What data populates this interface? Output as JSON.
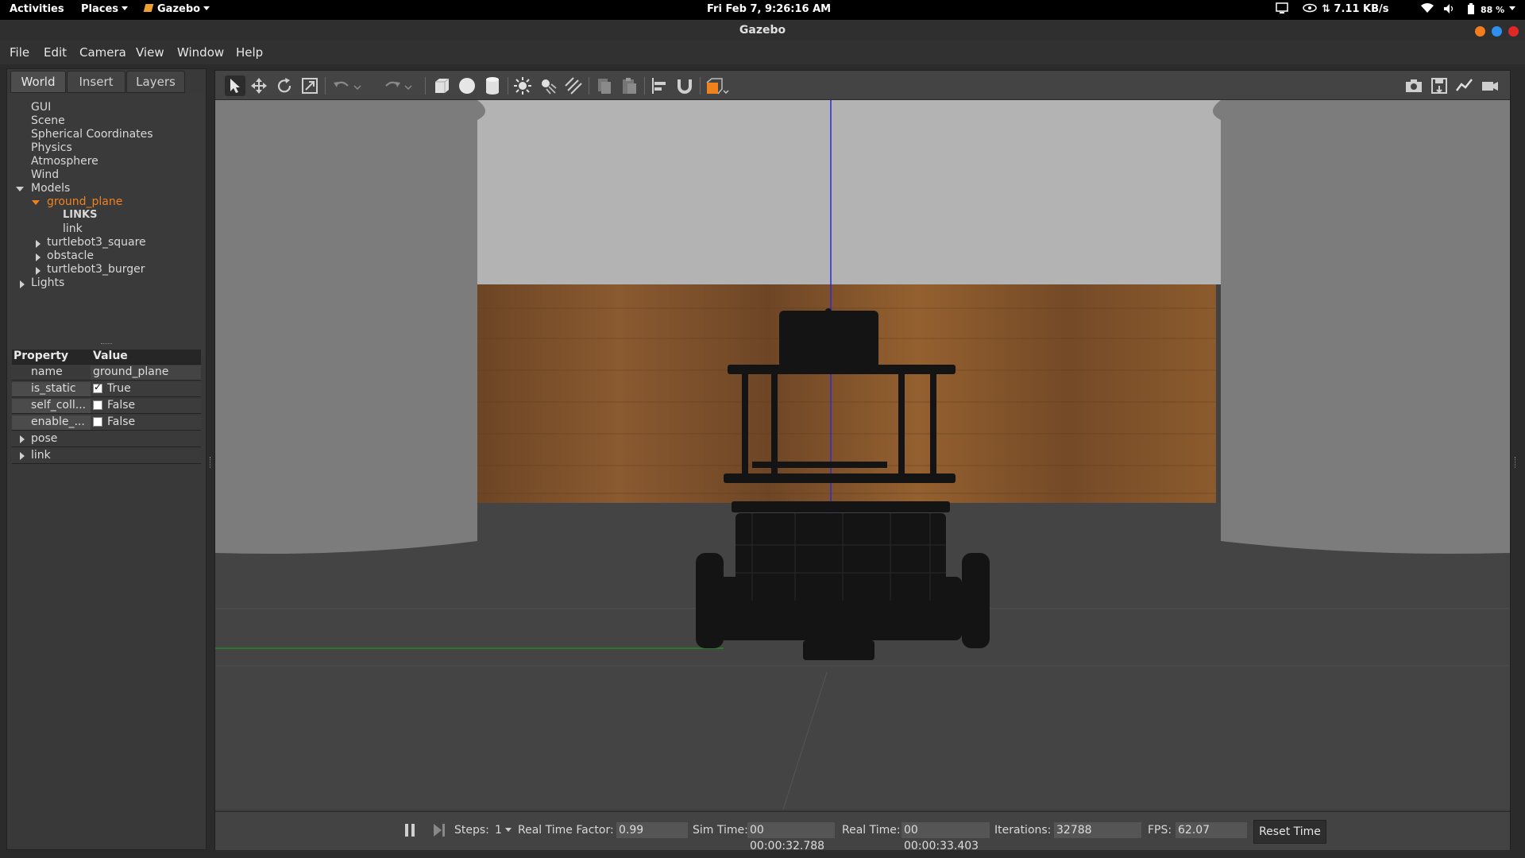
{
  "topbar": {
    "activities": "Activities",
    "places": "Places",
    "app": "Gazebo",
    "clock": "Fri Feb  7,  9:26:16 AM",
    "net_speed": "⇅ 7.11 KB/s",
    "battery": "88 %"
  },
  "window": {
    "title": "Gazebo"
  },
  "menu": {
    "items": [
      "File",
      "Edit",
      "Camera",
      "View",
      "Window",
      "Help"
    ]
  },
  "left_panel": {
    "tabs": [
      "World",
      "Insert",
      "Layers"
    ],
    "tree": {
      "gui": "GUI",
      "scene": "Scene",
      "spherical": "Spherical Coordinates",
      "physics": "Physics",
      "atmosphere": "Atmosphere",
      "wind": "Wind",
      "models": "Models",
      "ground_plane": "ground_plane",
      "links": "LINKS",
      "link": "link",
      "turtlebot3_square": "turtlebot3_square",
      "obstacle": "obstacle",
      "turtlebot3_burger": "turtlebot3_burger",
      "lights": "Lights"
    },
    "properties": {
      "header_property": "Property",
      "header_value": "Value",
      "rows": [
        {
          "name": "name",
          "value": "ground_plane"
        },
        {
          "name": "is_static",
          "value": "True",
          "checked": true
        },
        {
          "name": "self_coll...",
          "value": "False",
          "checked": false
        },
        {
          "name": "enable_...",
          "value": "False",
          "checked": false
        },
        {
          "name": "pose"
        },
        {
          "name": "link"
        }
      ]
    }
  },
  "statusbar": {
    "steps_label": "Steps:",
    "steps_value": "1",
    "rtf_label": "Real Time Factor:",
    "rtf_value": "0.99",
    "sim_time_label": "Sim Time:",
    "sim_time_value": "00 00:00:32.788",
    "real_time_label": "Real Time:",
    "real_time_value": "00 00:00:33.403",
    "iterations_label": "Iterations:",
    "iterations_value": "32788",
    "fps_label": "FPS:",
    "fps_value": "62.07",
    "reset_label": "Reset Time"
  },
  "colors": {
    "selection": "#f0821e",
    "background": "#2b2b2b"
  }
}
